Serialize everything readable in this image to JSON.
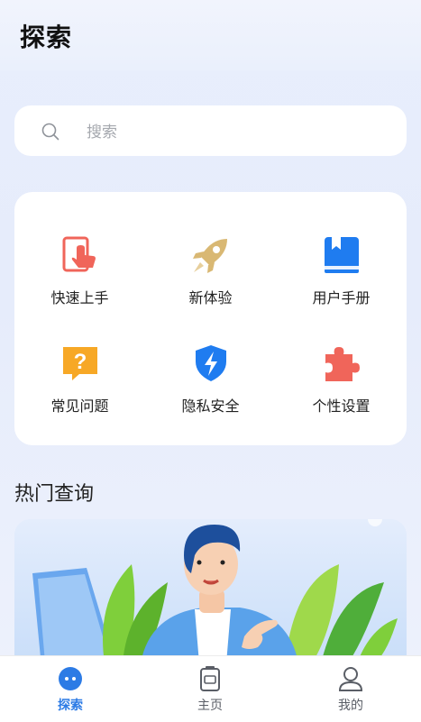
{
  "header": {
    "title": "探索"
  },
  "search": {
    "placeholder": "搜索",
    "icon": "search-icon"
  },
  "features": [
    {
      "label": "快速上手",
      "icon": "quick-start-icon",
      "color": "#f0655a"
    },
    {
      "label": "新体验",
      "icon": "rocket-icon",
      "color": "#d9b873"
    },
    {
      "label": "用户手册",
      "icon": "manual-book-icon",
      "color": "#1f7cf0"
    },
    {
      "label": "常见问题",
      "icon": "faq-icon",
      "color": "#f7a826"
    },
    {
      "label": "隐私安全",
      "icon": "shield-icon",
      "color": "#1f7cf0"
    },
    {
      "label": "个性设置",
      "icon": "puzzle-icon",
      "color": "#f0655a"
    }
  ],
  "hot": {
    "title": "热门查询"
  },
  "nav": {
    "items": [
      {
        "label": "探索",
        "icon": "explore-icon",
        "active": true
      },
      {
        "label": "主页",
        "icon": "home-device-icon",
        "active": false
      },
      {
        "label": "我的",
        "icon": "profile-icon",
        "active": false
      }
    ],
    "active_color": "#2c7be5"
  }
}
